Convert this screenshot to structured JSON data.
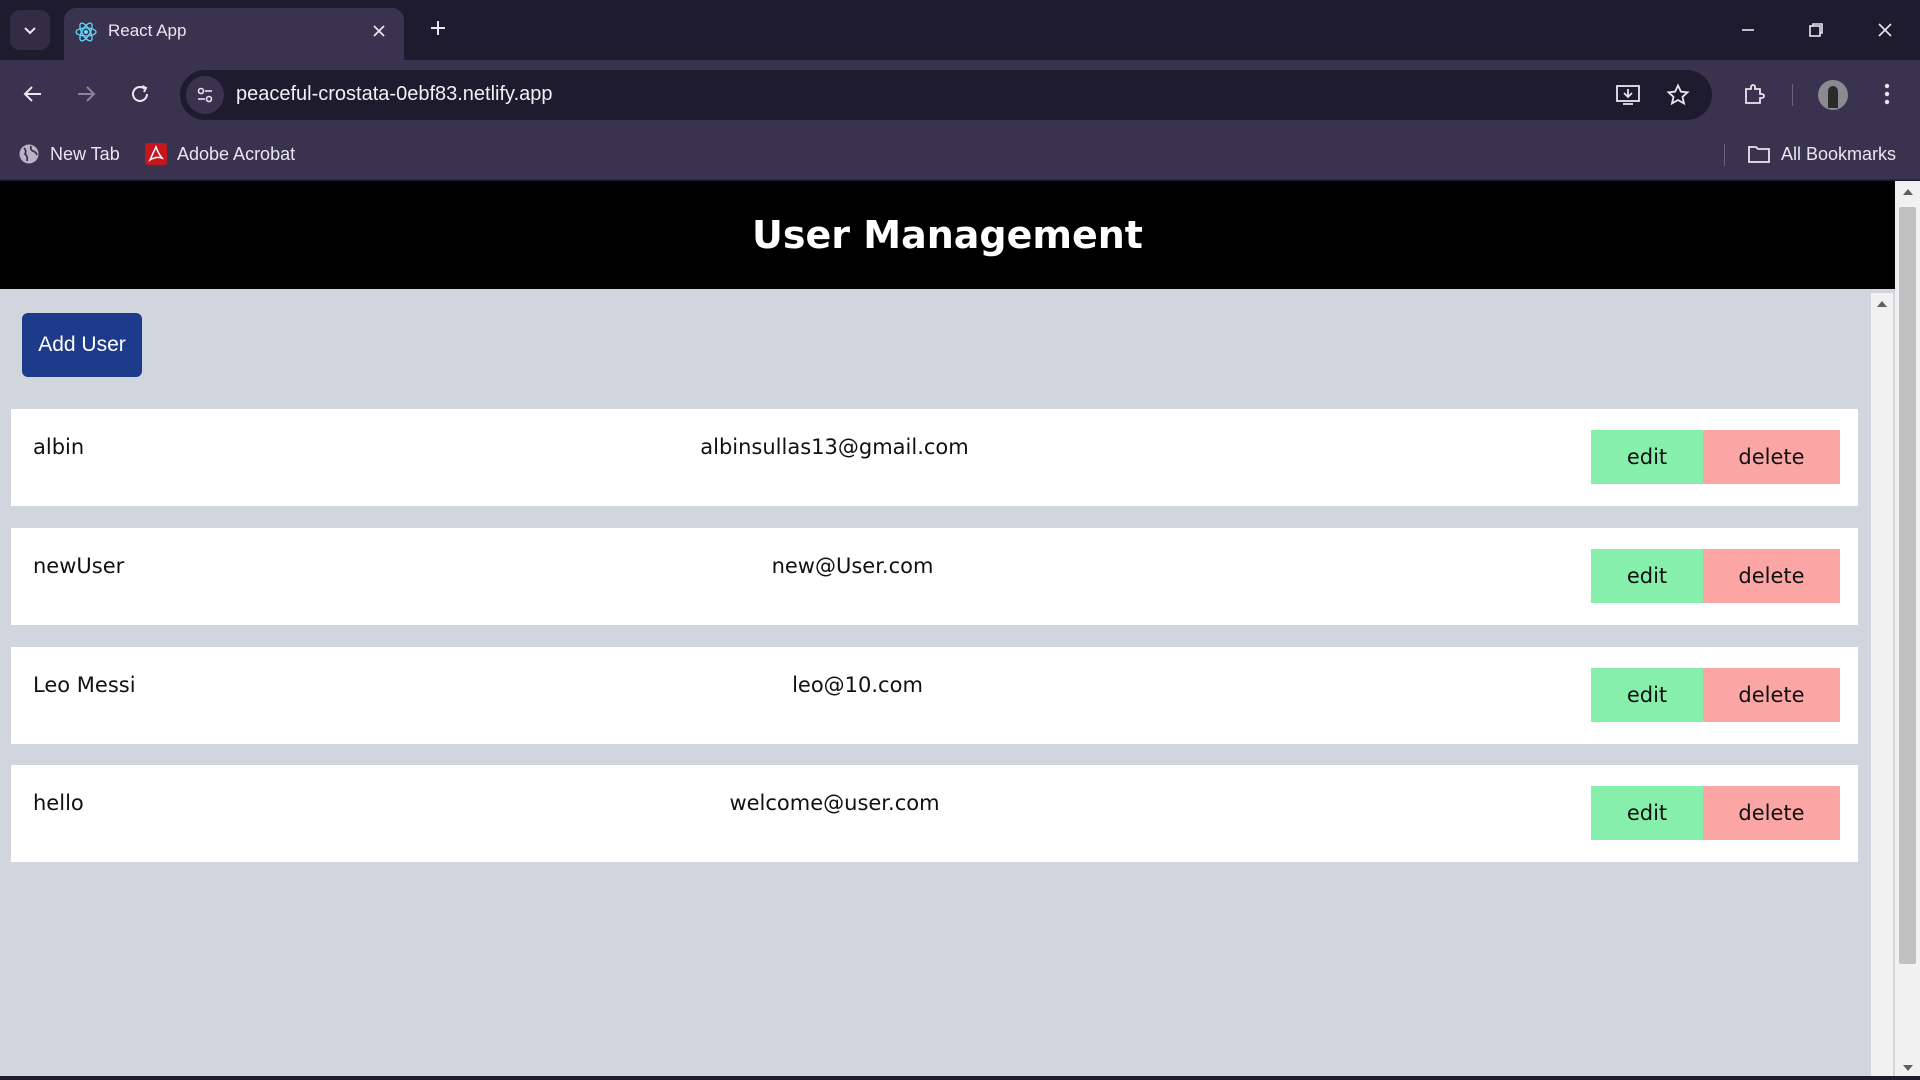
{
  "browser": {
    "tab_title": "React App",
    "url": "peaceful-crostata-0ebf83.netlify.app",
    "bookmarks": [
      {
        "label": "New Tab",
        "icon": "globe-icon"
      },
      {
        "label": "Adobe Acrobat",
        "icon": "acrobat-icon"
      }
    ],
    "all_bookmarks_label": "All Bookmarks"
  },
  "page": {
    "title": "User Management",
    "add_user_label": "Add User",
    "edit_label": "edit",
    "delete_label": "delete",
    "users": [
      {
        "name": "albin",
        "email": "albinsullas13@gmail.com"
      },
      {
        "name": "newUser",
        "email": "new@User.com"
      },
      {
        "name": "Leo Messi",
        "email": "leo@10.com"
      },
      {
        "name": "hello",
        "email": "welcome@user.com"
      }
    ]
  },
  "colors": {
    "header_bg": "#000000",
    "add_button": "#1e3a8a",
    "edit_button": "#86efac",
    "delete_button": "#fca5a5",
    "page_bg": "#d1d5dd"
  }
}
